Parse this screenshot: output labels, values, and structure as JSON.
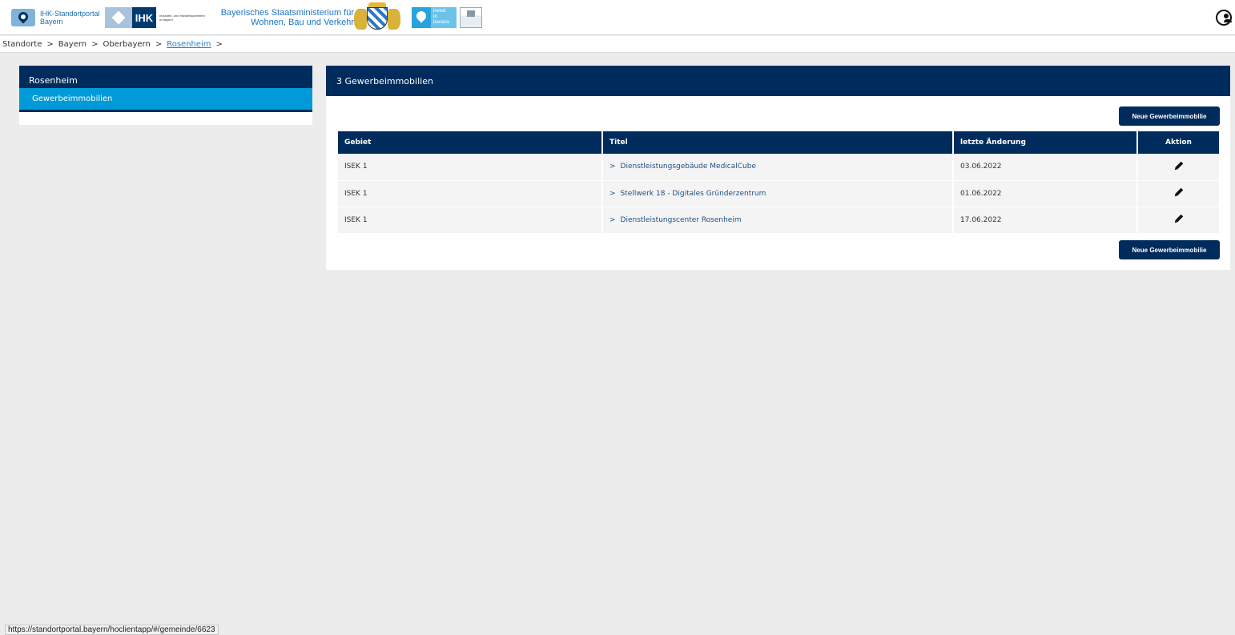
{
  "header": {
    "portal_logo": {
      "line1": "IHK-Standortportal",
      "line2": "Bayern"
    },
    "ihk_logo": {
      "word": "IHK",
      "subtitle": "Industrie- und Handelskammern in Bayern"
    },
    "ministry_logo": {
      "line1": "Bayerisches Staatsministerium für",
      "line2": "Wohnen, Bau und Verkehr"
    },
    "invest_logo": {
      "line1": "invest",
      "line2": "in",
      "line3": "bavaria"
    },
    "user_icon": "user-circle-icon"
  },
  "breadcrumb": {
    "items": [
      "Standorte",
      "Bayern",
      "Oberbayern",
      "Rosenheim"
    ],
    "separator": ">"
  },
  "sidebar": {
    "title": "Rosenheim",
    "items": [
      {
        "label": "Gewerbeimmobilien"
      }
    ]
  },
  "panel": {
    "title": "3 Gewerbeimmobilien",
    "new_button_label": "Neue Gewerbeimmobilie",
    "table": {
      "columns": [
        "Gebiet",
        "Titel",
        "letzte Änderung",
        "Aktion"
      ],
      "rows": [
        {
          "gebiet": "ISEK 1",
          "titel": "Dienstleistungsgebäude MedicalCube",
          "datum": "03.06.2022",
          "aktion_icon": "pencil-icon"
        },
        {
          "gebiet": "ISEK 1",
          "titel": "Stellwerk 18 - Digitales Gründerzentrum",
          "datum": "01.06.2022",
          "aktion_icon": "pencil-icon"
        },
        {
          "gebiet": "ISEK 1",
          "titel": "Dienstleistungscenter Rosenheim",
          "datum": "17.06.2022",
          "aktion_icon": "pencil-icon"
        }
      ],
      "link_chevron": ">"
    }
  },
  "status_bar": {
    "url": "https://standortportal.bayern/hoclientapp/#/gemeinde/6623"
  },
  "colors": {
    "navy": "#002c5d",
    "accent": "#009ad8",
    "background": "#ececec"
  }
}
